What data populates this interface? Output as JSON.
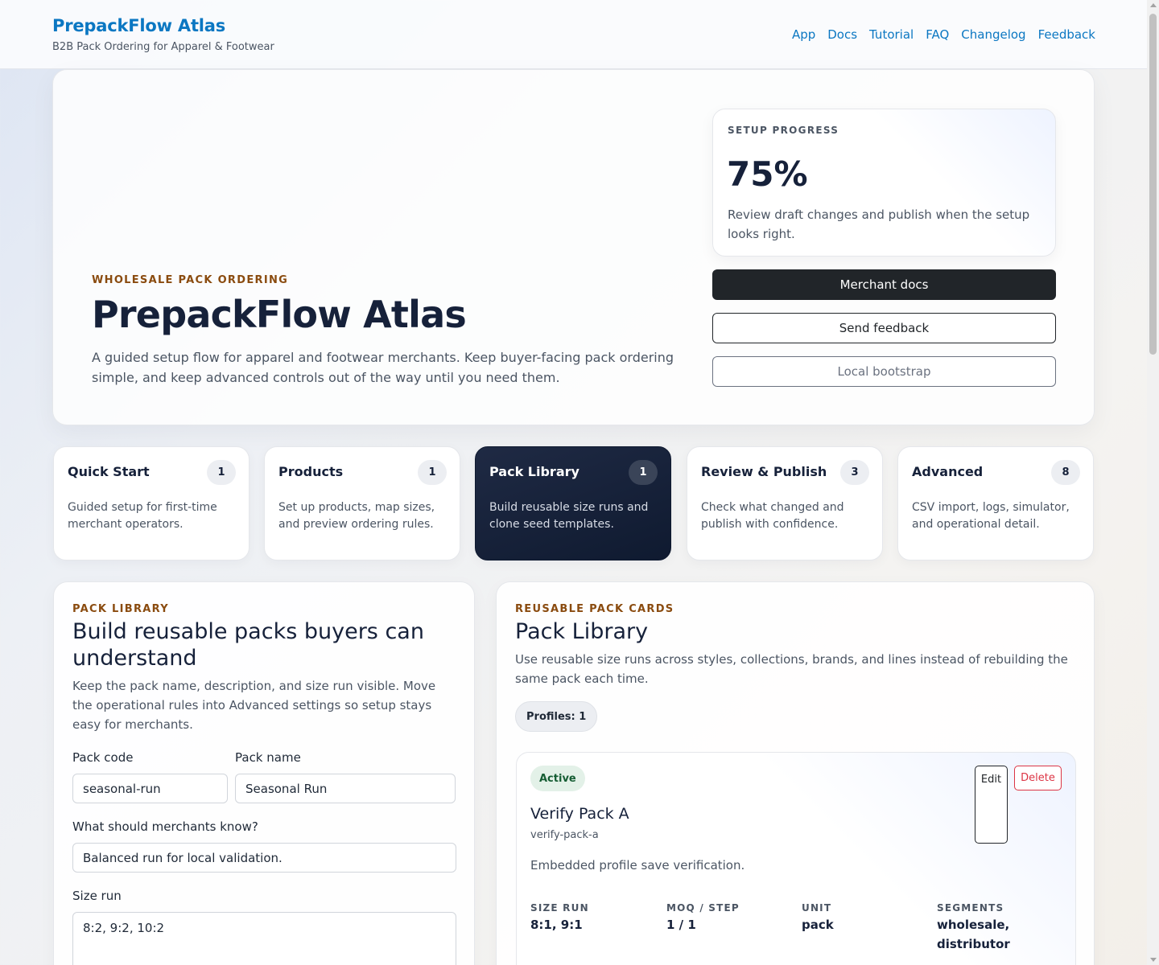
{
  "header": {
    "brand_title": "PrepackFlow Atlas",
    "brand_subtitle": "B2B Pack Ordering for Apparel & Footwear",
    "nav": [
      "App",
      "Docs",
      "Tutorial",
      "FAQ",
      "Changelog",
      "Feedback"
    ]
  },
  "hero": {
    "eyebrow": "WHOLESALE PACK ORDERING",
    "title": "PrepackFlow Atlas",
    "description": "A guided setup flow for apparel and footwear merchants. Keep buyer-facing pack ordering simple, and keep advanced controls out of the way until you need them.",
    "progress": {
      "label": "SETUP PROGRESS",
      "percent_text": "75%",
      "fraction": 0.75,
      "description": "Review draft changes and publish when the setup looks right."
    },
    "buttons": {
      "merchant_docs": "Merchant docs",
      "send_feedback": "Send feedback",
      "local_bootstrap": "Local bootstrap"
    }
  },
  "tabs": [
    {
      "title": "Quick Start",
      "count": "1",
      "description": "Guided setup for first-time merchant operators.",
      "active": false
    },
    {
      "title": "Products",
      "count": "1",
      "description": "Set up products, map sizes, and preview ordering rules.",
      "active": false
    },
    {
      "title": "Pack Library",
      "count": "1",
      "description": "Build reusable size runs and clone seed templates.",
      "active": true
    },
    {
      "title": "Review & Publish",
      "count": "3",
      "description": "Check what changed and publish with confidence.",
      "active": false
    },
    {
      "title": "Advanced",
      "count": "8",
      "description": "CSV import, logs, simulator, and operational detail.",
      "active": false
    }
  ],
  "pack_form": {
    "eyebrow": "PACK LIBRARY",
    "title": "Build reusable packs buyers can understand",
    "description": "Keep the pack name, description, and size run visible. Move the operational rules into Advanced settings so setup stays easy for merchants.",
    "pack_code_label": "Pack code",
    "pack_code_value": "seasonal-run",
    "pack_name_label": "Pack name",
    "pack_name_value": "Seasonal Run",
    "merchant_note_label": "What should merchants know?",
    "merchant_note_value": "Balanced run for local validation.",
    "size_run_label": "Size run",
    "size_run_value": "8:2, 9:2, 10:2"
  },
  "pack_library": {
    "eyebrow": "REUSABLE PACK CARDS",
    "title": "Pack Library",
    "description": "Use reusable size runs across styles, collections, brands, and lines instead of rebuilding the same pack each time.",
    "profiles_chip": "Profiles: 1",
    "card": {
      "status": "Active",
      "edit_label": "Edit",
      "delete_label": "Delete",
      "name": "Verify Pack A",
      "code": "verify-pack-a",
      "description": "Embedded profile save verification.",
      "stats": [
        {
          "label": "SIZE RUN",
          "value": "8:1, 9:1"
        },
        {
          "label": "MOQ / STEP",
          "value": "1 / 1"
        },
        {
          "label": "UNIT",
          "value": "pack"
        },
        {
          "label": "SEGMENTS",
          "value": "wholesale, distributor"
        }
      ]
    }
  },
  "colors": {
    "brand_blue": "#0b77c2",
    "eyebrow_brown": "#8a4b0f",
    "active_tab_navy": "#0f1a30",
    "status_green": "#155d33",
    "danger_red": "#dc3545"
  }
}
